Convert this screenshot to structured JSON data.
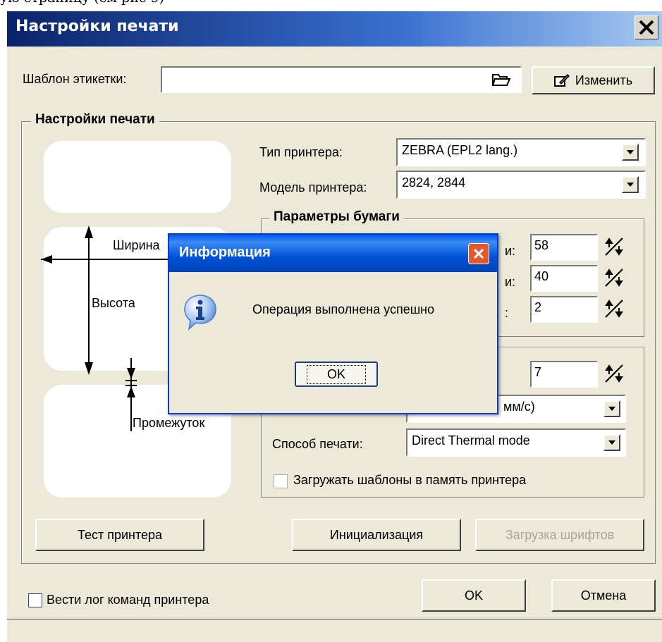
{
  "page_caption": "ую страницу (см рис 9)",
  "window": {
    "title": "Настройки печати",
    "template_label": "Шаблон этикетки:",
    "template_value": "",
    "change_button": "Изменить",
    "group_label": "Настройки печати",
    "printer_type_label": "Тип принтера:",
    "printer_type_value": "ZEBRA (EPL2 lang.)",
    "printer_model_label": "Модель принтера:",
    "printer_model_value": "2824, 2844",
    "paper_group_label": "Параметры бумаги",
    "paper_width_value": "58",
    "paper_height_value": "40",
    "paper_gap_value": "2",
    "density_value": "7",
    "speed_value": "мм/с)",
    "print_method_label": "Способ печати:",
    "print_method_value": "Direct Thermal mode",
    "load_templates_label": "Загружать шаблоны в память принтера",
    "diagram": {
      "width_label": "Ширина",
      "height_label": "Высота",
      "gap_label": "Промежуток"
    },
    "test_button": "Тест принтера",
    "init_button": "Инициализация",
    "fonts_button": "Загрузка шрифтов",
    "log_label": "Вести лог команд принтера",
    "ok_button": "OK",
    "cancel_button": "Отмена",
    "behind_fragments": {
      "width_tail": "и:",
      "height_tail": "и:",
      "gap_tail": ":"
    }
  },
  "dialog": {
    "title": "Информация",
    "message": "Операция выполнена успешно",
    "ok_button": "OK"
  }
}
